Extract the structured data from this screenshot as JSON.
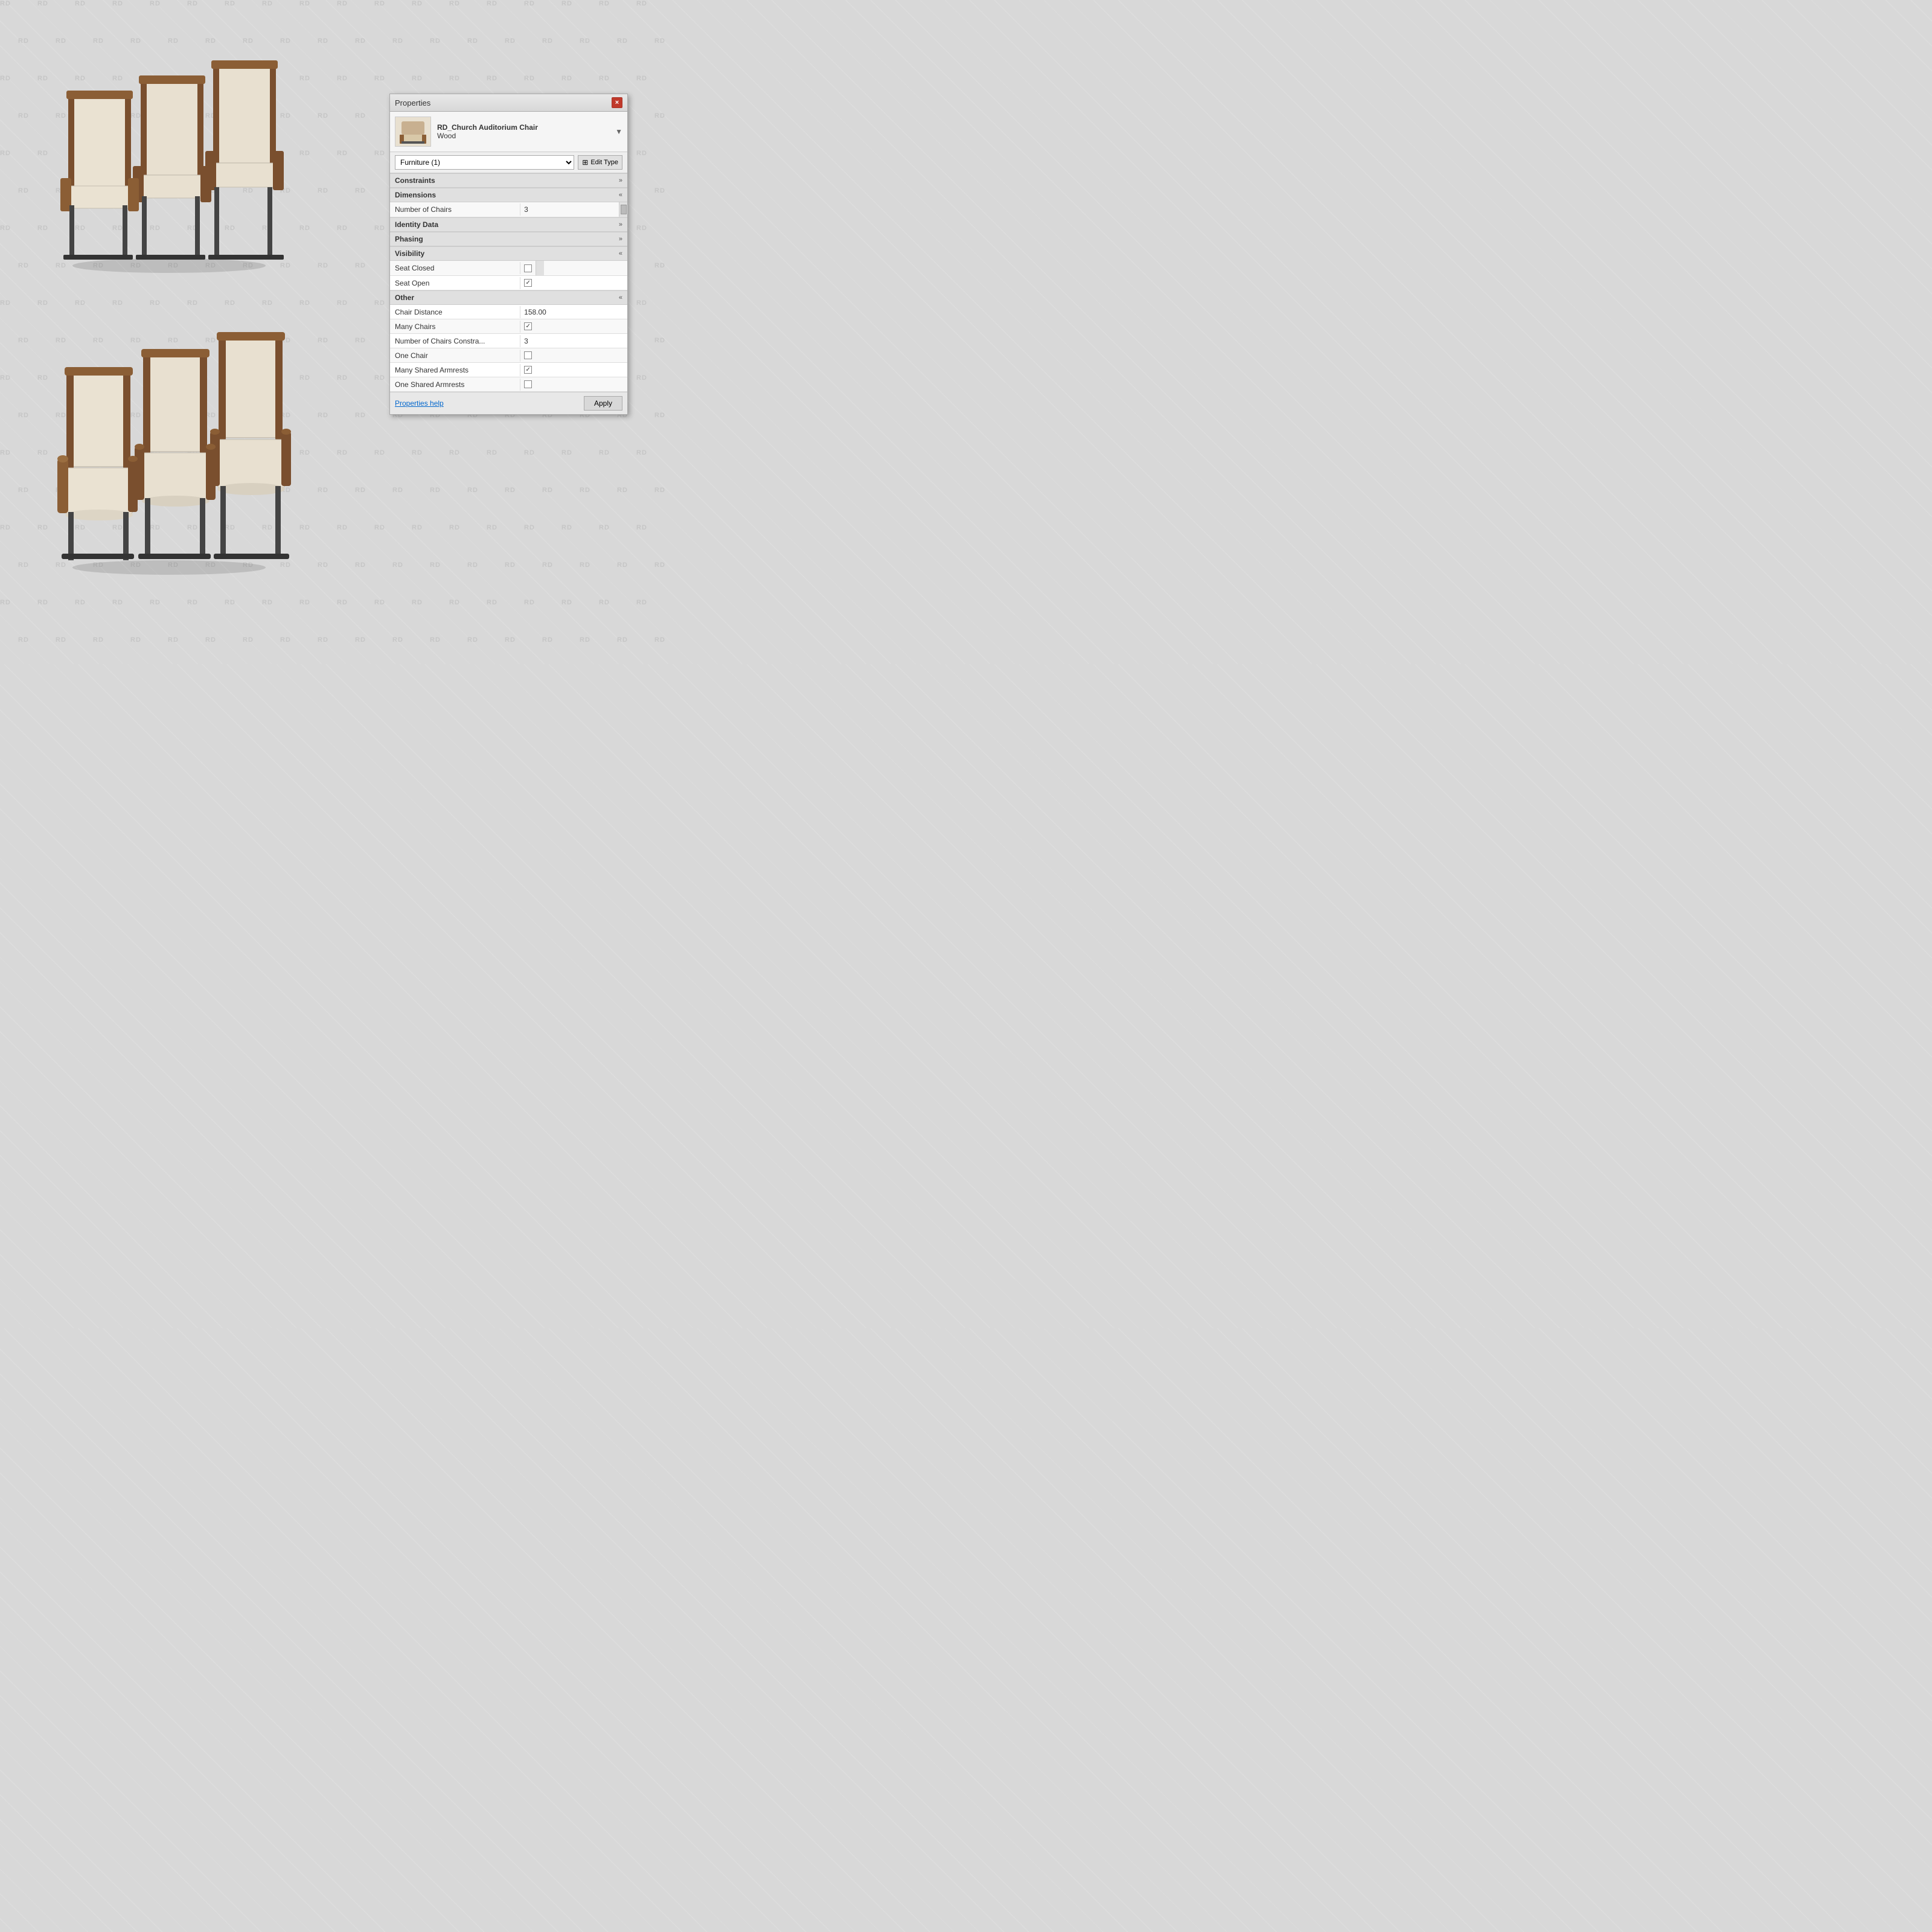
{
  "panel": {
    "title": "Properties",
    "close_label": "×",
    "item_name_line1": "RD_Church Auditorium Chair",
    "item_name_line2": "Wood",
    "category": "Furniture (1)",
    "edit_type_label": "Edit Type",
    "sections": {
      "constraints": {
        "label": "Constraints",
        "collapsed": true,
        "chevron": "»"
      },
      "dimensions": {
        "label": "Dimensions",
        "collapsed": false,
        "chevron": "«",
        "properties": [
          {
            "label": "Number of Chairs",
            "value": "3",
            "type": "text"
          }
        ]
      },
      "identity_data": {
        "label": "Identity Data",
        "collapsed": true,
        "chevron": "»"
      },
      "phasing": {
        "label": "Phasing",
        "collapsed": true,
        "chevron": "»"
      },
      "visibility": {
        "label": "Visibility",
        "collapsed": false,
        "chevron": "«",
        "properties": [
          {
            "label": "Seat Closed",
            "value": "",
            "type": "checkbox",
            "checked": false
          },
          {
            "label": "Seat Open",
            "value": "",
            "type": "checkbox",
            "checked": true
          }
        ]
      },
      "other": {
        "label": "Other",
        "collapsed": false,
        "chevron": "«",
        "properties": [
          {
            "label": "Chair Distance",
            "value": "158.00",
            "type": "text"
          },
          {
            "label": "Many Chairs",
            "value": "",
            "type": "checkbox",
            "checked": true
          },
          {
            "label": "Number of Chairs Constra...",
            "value": "3",
            "type": "text"
          },
          {
            "label": "One Chair",
            "value": "",
            "type": "checkbox",
            "checked": false
          },
          {
            "label": "Many Shared Armrests",
            "value": "",
            "type": "checkbox",
            "checked": true
          },
          {
            "label": "One Shared Armrests",
            "value": "",
            "type": "checkbox",
            "checked": false
          }
        ]
      }
    },
    "footer": {
      "help_link": "Properties help",
      "apply_label": "Apply"
    }
  },
  "watermark": {
    "text": "RD"
  }
}
